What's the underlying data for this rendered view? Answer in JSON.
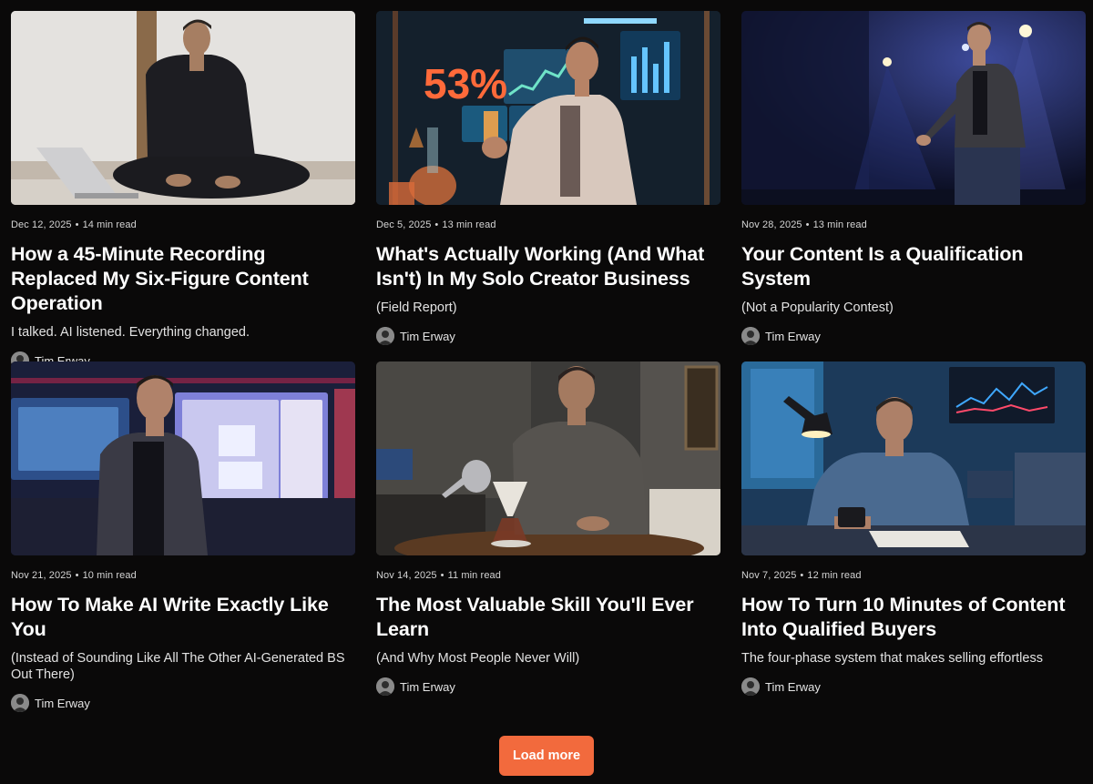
{
  "posts": [
    {
      "date": "Dec 12, 2025",
      "read_time": "14 min read",
      "title": "How a 45-Minute Recording Replaced My Six-Figure Content Operation",
      "subtitle": "I talked. AI listened. Everything changed.",
      "author": "Tim Erway"
    },
    {
      "date": "Dec 5, 2025",
      "read_time": "13 min read",
      "title": "What's Actually Working (And What Isn't) In My Solo Creator Business",
      "subtitle": "(Field Report)",
      "author": "Tim Erway",
      "image_text": "53%"
    },
    {
      "date": "Nov 28, 2025",
      "read_time": "13 min read",
      "title": "Your Content Is a Qualification System",
      "subtitle": "(Not a Popularity Contest)",
      "author": "Tim Erway"
    },
    {
      "date": "Nov 21, 2025",
      "read_time": "10 min read",
      "title": "How To Make AI Write Exactly Like You",
      "subtitle": "(Instead of Sounding Like All The Other AI-Generated BS Out There)",
      "author": "Tim Erway"
    },
    {
      "date": "Nov 14, 2025",
      "read_time": "11 min read",
      "title": "The Most Valuable Skill You'll Ever Learn",
      "subtitle": "(And Why Most People Never Will)",
      "author": "Tim Erway"
    },
    {
      "date": "Nov 7, 2025",
      "read_time": "12 min read",
      "title": "How To Turn 10 Minutes of Content Into Qualified Buyers",
      "subtitle": "The four-phase system that makes selling effortless",
      "author": "Tim Erway"
    }
  ],
  "meta_separator": "•",
  "load_more_label": "Load more",
  "colors": {
    "background": "#0a0909",
    "accent": "#f26a3d",
    "text": "#ffffff",
    "muted": "#d4d4d4"
  }
}
